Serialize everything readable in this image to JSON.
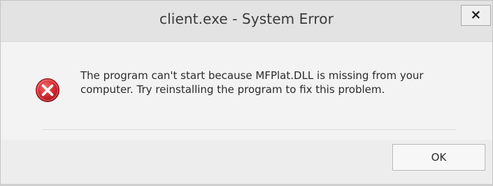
{
  "window": {
    "title": "client.exe - System Error",
    "close_glyph": "×"
  },
  "dialog": {
    "icon": "error-icon",
    "message": "The program can't start because MFPlat.DLL is missing from your computer. Try reinstalling the program to fix this problem."
  },
  "buttons": {
    "ok_label": "OK"
  },
  "colors": {
    "error_red": "#c8242f",
    "background": "#ededed"
  }
}
